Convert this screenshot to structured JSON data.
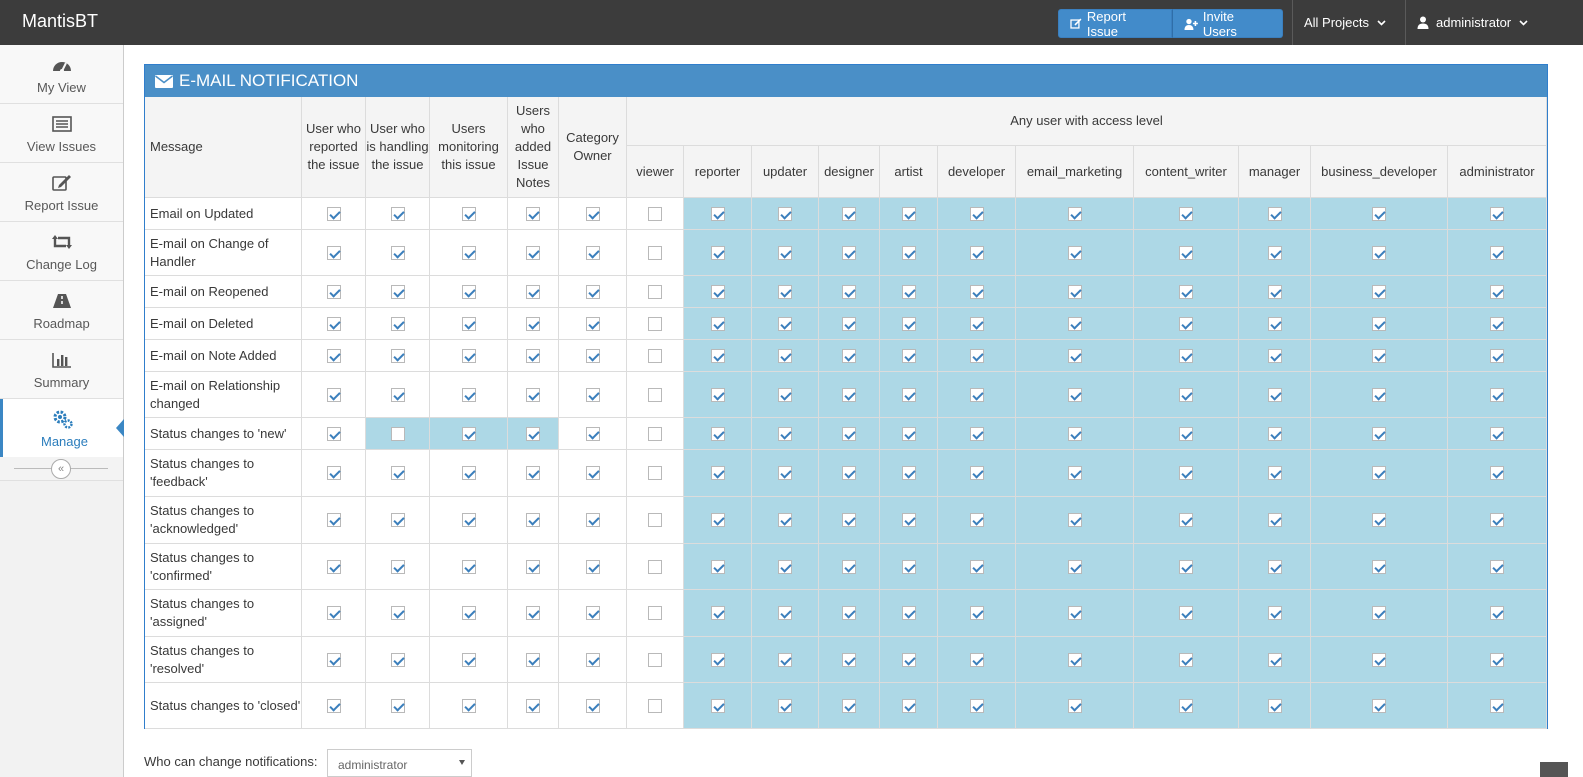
{
  "navbar": {
    "brand": "MantisBT",
    "report_issue_label": "Report Issue",
    "invite_users_label": "Invite Users",
    "project_selector": "All Projects",
    "user_menu": "administrator"
  },
  "sidebar": {
    "items": [
      {
        "label": "My View",
        "icon": "dashboard-icon"
      },
      {
        "label": "View Issues",
        "icon": "list-icon"
      },
      {
        "label": "Report Issue",
        "icon": "edit-icon"
      },
      {
        "label": "Change Log",
        "icon": "retweet-icon"
      },
      {
        "label": "Roadmap",
        "icon": "road-icon"
      },
      {
        "label": "Summary",
        "icon": "bar-chart-icon"
      },
      {
        "label": "Manage",
        "icon": "gears-icon"
      }
    ],
    "active_index": 6,
    "collapse_glyph": "«"
  },
  "notification": {
    "title": "E-MAIL NOTIFICATION",
    "message_header": "Message",
    "group_header": "Any user with access level",
    "role_columns": [
      "User who reported the issue",
      "User who is handling the issue",
      "Users monitoring this issue",
      "Users who added Issue Notes",
      "Category Owner"
    ],
    "access_levels": [
      "viewer",
      "reporter",
      "updater",
      "designer",
      "artist",
      "developer",
      "email_marketing",
      "content_writer",
      "manager",
      "business_developer",
      "administrator"
    ],
    "rows": [
      {
        "message": "Email on Updated",
        "checks": [
          1,
          1,
          1,
          1,
          1,
          0,
          1,
          1,
          1,
          1,
          1,
          1,
          1,
          1,
          1,
          1
        ]
      },
      {
        "message": "E-mail on Change of Handler",
        "checks": [
          1,
          1,
          1,
          1,
          1,
          0,
          1,
          1,
          1,
          1,
          1,
          1,
          1,
          1,
          1,
          1
        ]
      },
      {
        "message": "E-mail on Reopened",
        "checks": [
          1,
          1,
          1,
          1,
          1,
          0,
          1,
          1,
          1,
          1,
          1,
          1,
          1,
          1,
          1,
          1
        ]
      },
      {
        "message": "E-mail on Deleted",
        "checks": [
          1,
          1,
          1,
          1,
          1,
          0,
          1,
          1,
          1,
          1,
          1,
          1,
          1,
          1,
          1,
          1
        ]
      },
      {
        "message": "E-mail on Note Added",
        "checks": [
          1,
          1,
          1,
          1,
          1,
          0,
          1,
          1,
          1,
          1,
          1,
          1,
          1,
          1,
          1,
          1
        ]
      },
      {
        "message": "E-mail on Relationship changed",
        "checks": [
          1,
          1,
          1,
          1,
          1,
          0,
          1,
          1,
          1,
          1,
          1,
          1,
          1,
          1,
          1,
          1
        ]
      },
      {
        "message": "Status changes to 'new'",
        "checks": [
          1,
          0,
          1,
          1,
          1,
          0,
          1,
          1,
          1,
          1,
          1,
          1,
          1,
          1,
          1,
          1
        ]
      },
      {
        "message": "Status changes to 'feedback'",
        "checks": [
          1,
          1,
          1,
          1,
          1,
          0,
          1,
          1,
          1,
          1,
          1,
          1,
          1,
          1,
          1,
          1
        ]
      },
      {
        "message": "Status changes to 'acknowledged'",
        "checks": [
          1,
          1,
          1,
          1,
          1,
          0,
          1,
          1,
          1,
          1,
          1,
          1,
          1,
          1,
          1,
          1
        ]
      },
      {
        "message": "Status changes to 'confirmed'",
        "checks": [
          1,
          1,
          1,
          1,
          1,
          0,
          1,
          1,
          1,
          1,
          1,
          1,
          1,
          1,
          1,
          1
        ]
      },
      {
        "message": "Status changes to 'assigned'",
        "checks": [
          1,
          1,
          1,
          1,
          1,
          0,
          1,
          1,
          1,
          1,
          1,
          1,
          1,
          1,
          1,
          1
        ]
      },
      {
        "message": "Status changes to 'resolved'",
        "checks": [
          1,
          1,
          1,
          1,
          1,
          0,
          1,
          1,
          1,
          1,
          1,
          1,
          1,
          1,
          1,
          1
        ]
      },
      {
        "message": "Status changes to 'closed'",
        "checks": [
          1,
          1,
          1,
          1,
          1,
          0,
          1,
          1,
          1,
          1,
          1,
          1,
          1,
          1,
          1,
          1
        ]
      }
    ],
    "highlighted_role_cells": [
      [
        6,
        1
      ],
      [
        6,
        2
      ],
      [
        6,
        3
      ]
    ],
    "highlight_color": "#add8e6"
  },
  "footer": {
    "who_can_change_label": "Who can change notifications:",
    "who_can_change_value": "administrator"
  },
  "colors": {
    "navbar": "#3c3c3c",
    "accent": "#428bca",
    "widget_header": "#4a8fc7"
  }
}
